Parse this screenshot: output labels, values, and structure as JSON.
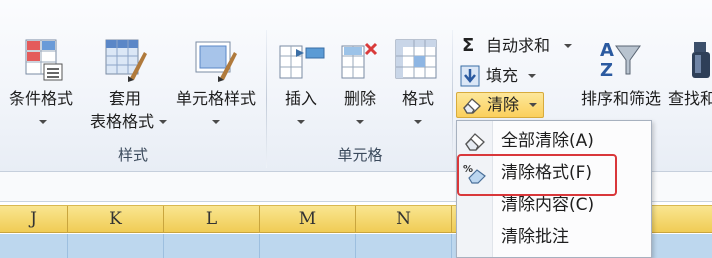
{
  "ribbon": {
    "styles_group": {
      "label": "样式",
      "conditional_format": "条件格式",
      "table_format_line1": "套用",
      "table_format_line2": "表格格式",
      "cell_styles": "单元格样式"
    },
    "cells_group": {
      "label": "单元格",
      "insert": "插入",
      "delete": "删除",
      "format": "格式"
    },
    "editing_group": {
      "autosum": "自动求和",
      "autosum_symbol": "Σ",
      "fill": "填充",
      "clear": "清除",
      "sort_filter": "排序和筛选",
      "find_select": "查找和"
    }
  },
  "clear_menu": {
    "items": [
      {
        "label": "全部清除(A)",
        "icon": "eraser-icon"
      },
      {
        "label": "清除格式(F)",
        "icon": "clear-format-icon"
      },
      {
        "label": "清除内容(C)",
        "icon": ""
      },
      {
        "label": "清除批注",
        "icon": ""
      }
    ],
    "highlighted_item": "清除格式(F)",
    "highlight_color": "#d9373a"
  },
  "sheet": {
    "columns": [
      "J",
      "K",
      "L",
      "M",
      "N",
      "",
      "",
      ""
    ],
    "header_color": "#f0cc55",
    "selected_row_color": "#bdd7ee"
  }
}
